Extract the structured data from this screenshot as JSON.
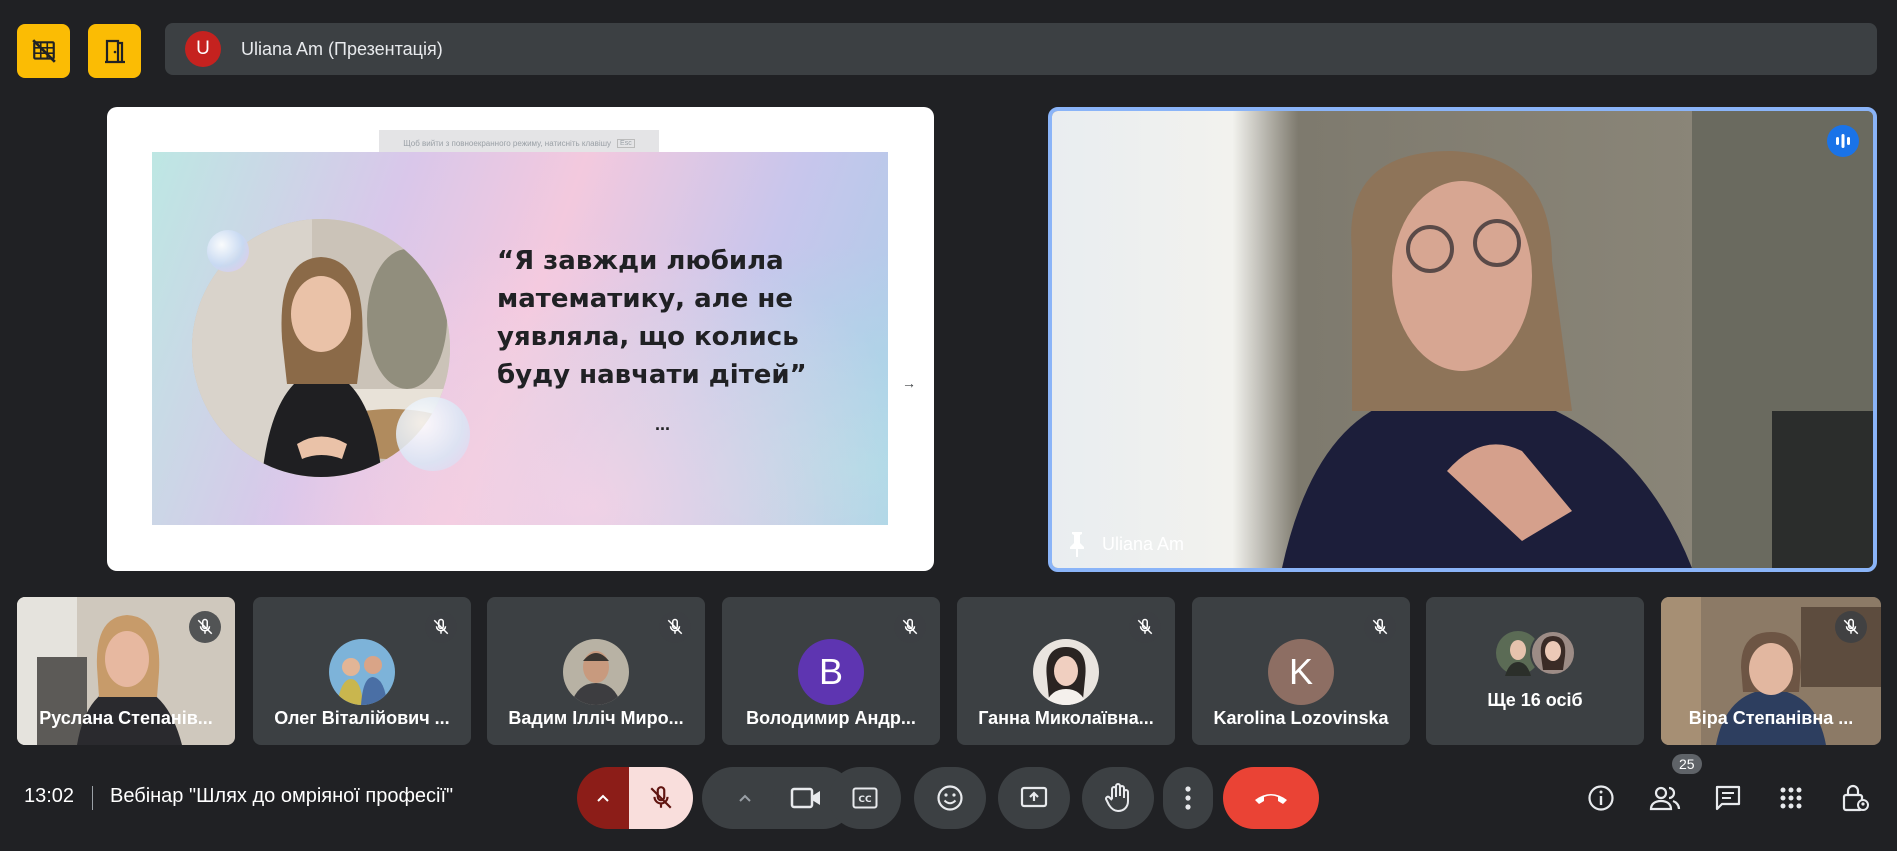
{
  "presenter": {
    "avatar_letter": "U",
    "label": "Uliana Am (Презентація)"
  },
  "slide": {
    "hint": "Щоб вийти з повноекранного режиму, натисніть клавішу",
    "hint_key": "Esc",
    "quote": "“Я завжди любила математику, але не уявляла, що колись буду навчати дітей”",
    "ellipsis": "..."
  },
  "speaker": {
    "name": "Uliana Am"
  },
  "participants": [
    {
      "name": "Руслана Степанів..."
    },
    {
      "name": "Олег Віталійович ..."
    },
    {
      "name": "Вадим Ілліч Миро..."
    },
    {
      "name": "Володимир Андр...",
      "avatar_letter": "B",
      "avatar_color": "#5e35b1"
    },
    {
      "name": "Ганна Миколаївна..."
    },
    {
      "name": "Karolina Lozovinska",
      "avatar_letter": "K",
      "avatar_color": "#8d6e63"
    },
    {
      "name": "Ще 16 осіб"
    },
    {
      "name": "Віра Степанівна ..."
    }
  ],
  "bottom": {
    "time": "13:02",
    "meeting_title": "Вебінар \"Шлях до омріяної професії\"",
    "participant_count": "25"
  },
  "colors": {
    "accent_yellow": "#fbbc04",
    "hangup_red": "#ea4335",
    "active_border": "#8ab4f8",
    "mic_off_bg": "#f9dedc"
  }
}
